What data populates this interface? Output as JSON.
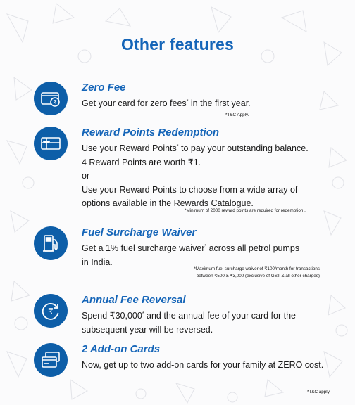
{
  "page": {
    "title": "Other features"
  },
  "features": [
    {
      "title": "Zero Fee",
      "icon": "card-rupee-icon",
      "lines": [
        {
          "before": "Get your card for zero fees",
          "sup": "*",
          "after": " in the first year."
        }
      ],
      "note": "*T&C Apply."
    },
    {
      "title": "Reward Points Redemption",
      "icon": "gift-card-icon",
      "lines": [
        {
          "before": "Use your Reward Points",
          "sup": "*",
          "after": " to pay your outstanding balance."
        },
        {
          "before": "4 Reward Points are worth ₹1.",
          "sup": "",
          "after": ""
        },
        {
          "before": "or",
          "sup": "",
          "after": ""
        },
        {
          "before": "Use your Reward Points to choose from a wide array of",
          "sup": "",
          "after": ""
        },
        {
          "before": "options available in the Rewards Catalogue.",
          "sup": "",
          "after": ""
        }
      ],
      "note": "*Minimum of 2000 reward points are required for redemption ."
    },
    {
      "title": "Fuel Surcharge Waiver",
      "icon": "fuel-pump-icon",
      "lines": [
        {
          "before": "Get a 1% fuel surcharge waiver",
          "sup": "*",
          "after": " across all petrol pumps"
        },
        {
          "before": "in India.",
          "sup": "",
          "after": ""
        }
      ],
      "note_lines": [
        "*Maximum fuel surcharge waiver of ₹100/month for transactions",
        "between ₹500 & ₹3,000 (exclusive of GST & all other charges)"
      ]
    },
    {
      "title": "Annual Fee Reversal",
      "icon": "rupee-cycle-icon",
      "lines": [
        {
          "before": "Spend ₹30,000",
          "sup": "*",
          "after": " and the annual fee of your card for the"
        },
        {
          "before": "subsequent year will be reversed.",
          "sup": "",
          "after": ""
        }
      ]
    },
    {
      "title": "2 Add-on Cards",
      "icon": "add-on-cards-icon",
      "lines": [
        {
          "before": "Now, get up to two add-on cards for your family at ZERO cost.",
          "sup": "",
          "after": ""
        }
      ],
      "note": "*T&C apply."
    }
  ],
  "colors": {
    "accent": "#1565b8",
    "icon_bg": "#0d5ea8"
  }
}
